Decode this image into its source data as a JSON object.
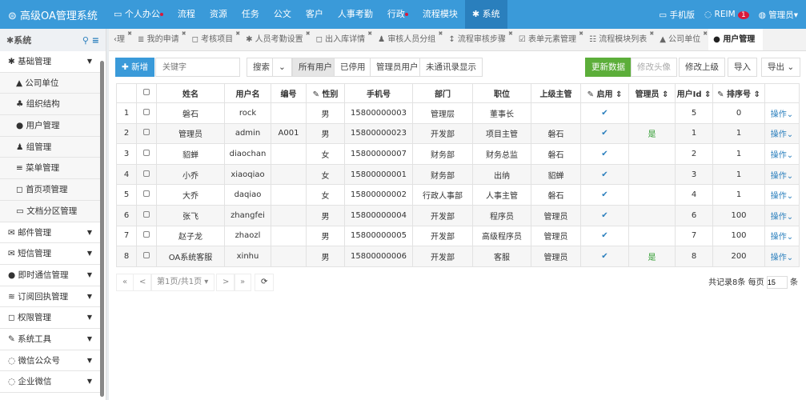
{
  "app": {
    "title": "高级OA管理系统",
    "nav": [
      {
        "label": "个人办公",
        "icon": "monitor-icon",
        "dot": true
      },
      {
        "label": "流程"
      },
      {
        "label": "资源"
      },
      {
        "label": "任务"
      },
      {
        "label": "公文"
      },
      {
        "label": "客户"
      },
      {
        "label": "人事考勤"
      },
      {
        "label": "行政",
        "dot": true
      },
      {
        "label": "流程模块"
      },
      {
        "label": "系统",
        "icon": "gear-icon",
        "active": true
      }
    ],
    "mobile": "手机版",
    "reim": "REIM",
    "reim_badge": "1",
    "user": "管理员"
  },
  "sidebar": {
    "title": "系统",
    "items": [
      {
        "label": "基础管理",
        "icon": "✱",
        "open": true
      },
      {
        "label": "公司单位",
        "icon": "▲",
        "sub": true
      },
      {
        "label": "组织结构",
        "icon": "♣",
        "sub": true
      },
      {
        "label": "用户管理",
        "icon": "●",
        "sub": true
      },
      {
        "label": "组管理",
        "icon": "♟",
        "sub": true
      },
      {
        "label": "菜单管理",
        "icon": "≡",
        "sub": true
      },
      {
        "label": "首页项管理",
        "icon": "◻",
        "sub": true
      },
      {
        "label": "文档分区管理",
        "icon": "▭",
        "sub": true
      },
      {
        "label": "邮件管理",
        "icon": "✉"
      },
      {
        "label": "短信管理",
        "icon": "✉"
      },
      {
        "label": "即时通信管理",
        "icon": "●"
      },
      {
        "label": "订阅回执管理",
        "icon": "≋"
      },
      {
        "label": "权限管理",
        "icon": "◻"
      },
      {
        "label": "系统工具",
        "icon": "✎"
      },
      {
        "label": "微信公众号",
        "icon": "◌"
      },
      {
        "label": "企业微信",
        "icon": "◌"
      }
    ]
  },
  "tabs": [
    {
      "label": "理",
      "prefix": "‹"
    },
    {
      "label": "我的申请",
      "icon": "≣"
    },
    {
      "label": "考核项目",
      "icon": "◻"
    },
    {
      "label": "人员考勤设置",
      "icon": "✱"
    },
    {
      "label": "出入库详情",
      "icon": "◻"
    },
    {
      "label": "审核人员分组",
      "icon": "♟"
    },
    {
      "label": "流程审核步骤",
      "icon": "↕"
    },
    {
      "label": "表单元素管理",
      "icon": "☑"
    },
    {
      "label": "流程模块列表",
      "icon": "☷"
    },
    {
      "label": "公司单位",
      "icon": "▲"
    },
    {
      "label": "用户管理",
      "icon": "●",
      "active": true
    }
  ],
  "toolbar": {
    "add": "新增",
    "keyword_placeholder": "关键字",
    "search": "搜索",
    "filters": [
      "所有用户",
      "已停用",
      "管理员用户",
      "未通讯录显示"
    ],
    "refresh": "更新数据",
    "avatar": "修改头像",
    "superior": "修改上级",
    "import": "导入",
    "export": "导出"
  },
  "table": {
    "headers": [
      "",
      "",
      "姓名",
      "用户名",
      "编号",
      "性别",
      "手机号",
      "部门",
      "职位",
      "上级主管",
      "启用",
      "管理员",
      "用户Id",
      "排序号",
      ""
    ],
    "rows": [
      [
        "1",
        "磐石",
        "rock",
        "",
        "男",
        "15800000003",
        "管理层",
        "董事长",
        "",
        true,
        "",
        "5",
        "0"
      ],
      [
        "2",
        "管理员",
        "admin",
        "A001",
        "男",
        "15800000023",
        "开发部",
        "项目主管",
        "磐石",
        true,
        "是",
        "1",
        "1"
      ],
      [
        "3",
        "貂蝉",
        "diaochan",
        "",
        "女",
        "15800000007",
        "财务部",
        "财务总监",
        "磐石",
        true,
        "",
        "2",
        "1"
      ],
      [
        "4",
        "小乔",
        "xiaoqiao",
        "",
        "女",
        "15800000001",
        "财务部",
        "出纳",
        "貂蝉",
        true,
        "",
        "3",
        "1"
      ],
      [
        "5",
        "大乔",
        "daqiao",
        "",
        "女",
        "15800000002",
        "行政人事部",
        "人事主管",
        "磐石",
        true,
        "",
        "4",
        "1"
      ],
      [
        "6",
        "张飞",
        "zhangfei",
        "",
        "男",
        "15800000004",
        "开发部",
        "程序员",
        "管理员",
        true,
        "",
        "6",
        "100"
      ],
      [
        "7",
        "赵子龙",
        "zhaozl",
        "",
        "男",
        "15800000005",
        "开发部",
        "高级程序员",
        "管理员",
        true,
        "",
        "7",
        "100"
      ],
      [
        "8",
        "OA系统客服",
        "xinhu",
        "",
        "男",
        "15800000006",
        "开发部",
        "客服",
        "管理员",
        true,
        "是",
        "8",
        "200"
      ]
    ],
    "op": "操作"
  },
  "pager": {
    "first": "«",
    "prev": "<",
    "page": "第1页/共1页",
    "next": ">",
    "last": "»",
    "total": "共记录8条",
    "per_page_label": "每页",
    "per_page": "15",
    "unit": "条"
  }
}
